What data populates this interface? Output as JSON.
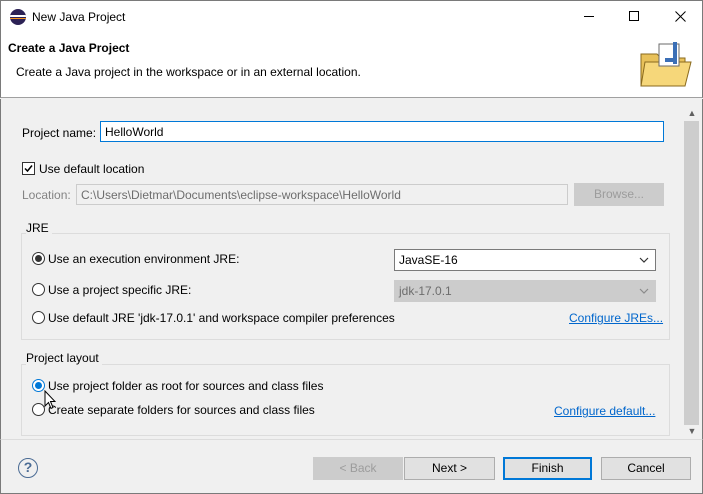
{
  "window": {
    "title": "New Java Project",
    "minimize_icon": "minimize-icon",
    "maximize_icon": "maximize-icon",
    "close_icon": "close-icon"
  },
  "header": {
    "title": "Create a Java Project",
    "description": "Create a Java project in the workspace or in an external location.",
    "icon": "java-project-folder-icon"
  },
  "form": {
    "project_name_label": "Project name:",
    "project_name_value": "HelloWorld",
    "use_default_location_label": "Use default location",
    "use_default_location_checked": true,
    "location_label": "Location:",
    "location_value": "C:\\Users\\Dietmar\\Documents\\eclipse-workspace\\HelloWorld",
    "browse_label": "Browse..."
  },
  "jre": {
    "group_title": "JRE",
    "option_execution_env_label": "Use an execution environment JRE:",
    "option_execution_env_value": "JavaSE-16",
    "option_project_specific_label": "Use a project specific JRE:",
    "option_project_specific_value": "jdk-17.0.1",
    "option_default_label": "Use default JRE 'jdk-17.0.1' and workspace compiler preferences",
    "configure_link": "Configure JREs...",
    "selected": "execution_env"
  },
  "layout": {
    "group_title": "Project layout",
    "option_root_label": "Use project folder as root for sources and class files",
    "option_separate_label": "Create separate folders for sources and class files",
    "configure_link": "Configure default...",
    "selected": "root"
  },
  "footer": {
    "help_icon": "help-icon",
    "help_glyph": "?",
    "back_label": "< Back",
    "next_label": "Next >",
    "finish_label": "Finish",
    "cancel_label": "Cancel"
  },
  "colors": {
    "accent": "#0078d7",
    "link": "#0066cc"
  }
}
